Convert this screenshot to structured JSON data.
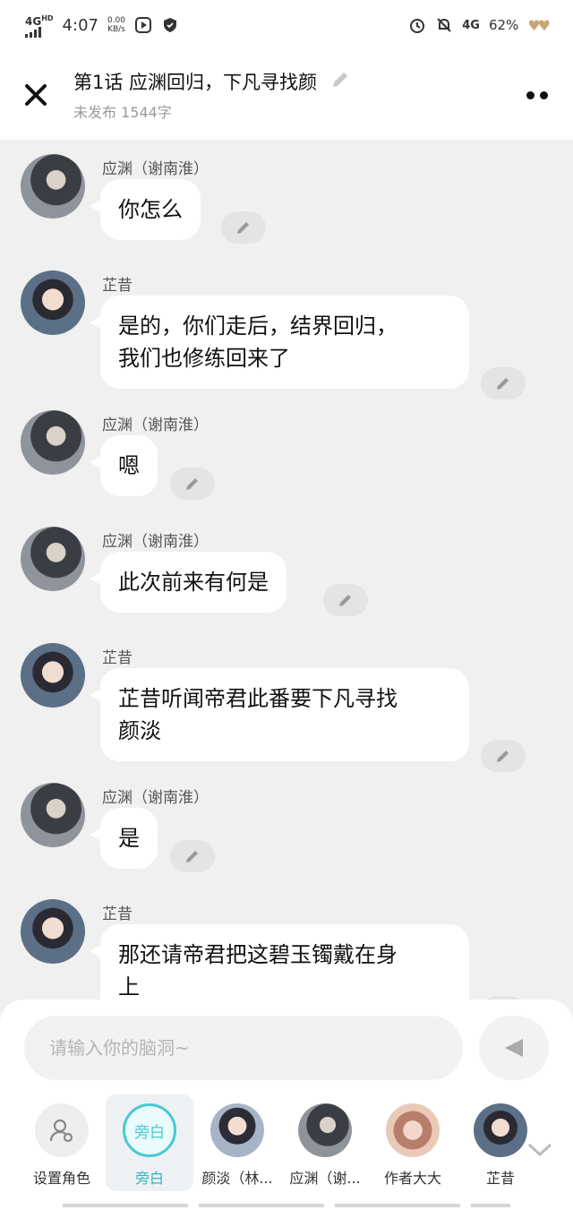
{
  "status_bar": {
    "network": "4G",
    "network_sup": "HD",
    "time": "4:07",
    "net_speed_value": "0.00",
    "net_speed_unit": "KB/s",
    "network_right": "4G",
    "battery": "62%",
    "icons": [
      "play-icon",
      "shield-icon",
      "alarm-icon",
      "mute-bell-icon",
      "battery-icon",
      "hearts-icon"
    ]
  },
  "header": {
    "title": "第1话  应渊回归，下凡寻找颜",
    "subtitle": "未发布 1544字"
  },
  "messages": [
    {
      "speaker": "应渊（谢南淮）",
      "text": "你怎么",
      "avatar": "yingyuan"
    },
    {
      "speaker": "芷昔",
      "text": "是的，你们走后，结界回归，\n我们也修练回来了",
      "avatar": "zhixi"
    },
    {
      "speaker": "应渊（谢南淮）",
      "text": "嗯",
      "avatar": "yingyuan"
    },
    {
      "speaker": "应渊（谢南淮）",
      "text": "此次前来有何是",
      "avatar": "yingyuan"
    },
    {
      "speaker": "芷昔",
      "text": "芷昔听闻帝君此番要下凡寻找\n颜淡",
      "avatar": "zhixi"
    },
    {
      "speaker": "应渊（谢南淮）",
      "text": "是",
      "avatar": "yingyuan"
    },
    {
      "speaker": "芷昔",
      "text": "那还请帝君把这碧玉镯戴在身\n上",
      "avatar": "zhixi"
    }
  ],
  "input": {
    "placeholder": "请输入你的脑洞~"
  },
  "roles": [
    {
      "label": "设置角色",
      "avatar_text": ""
    },
    {
      "label": "旁白",
      "avatar_text": "旁白"
    },
    {
      "label": "颜淡（林...",
      "avatar_text": ""
    },
    {
      "label": "应渊（谢...",
      "avatar_text": ""
    },
    {
      "label": "作者大大",
      "avatar_text": ""
    },
    {
      "label": "芷昔",
      "avatar_text": ""
    }
  ],
  "colors": {
    "accent": "#47c9d3",
    "background": "#f0f0f0",
    "bubble": "#ffffff"
  }
}
